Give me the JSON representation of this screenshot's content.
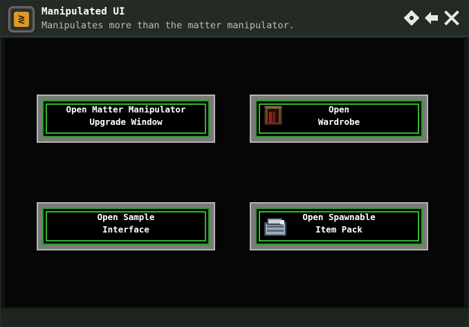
{
  "header": {
    "title": "Manipulated UI",
    "subtitle": "Manipulates more than the matter manipulator.",
    "app_icon": "starbound-logo-icon",
    "settings_icon": "gear-icon",
    "back_icon": "arrow-left-icon",
    "close_icon": "close-icon"
  },
  "buttons": [
    {
      "line1": "Open Matter Manipulator",
      "line2": "Upgrade Window",
      "icon": null
    },
    {
      "line1": "Open",
      "line2": "Wardrobe",
      "icon": "wardrobe-icon"
    },
    {
      "line1": "Open Sample",
      "line2": "Interface",
      "icon": null
    },
    {
      "line1": "Open Spawnable",
      "line2": "Item Pack",
      "icon": "item-pack-icon"
    }
  ],
  "colors": {
    "accent_green": "#33b433",
    "logo_orange": "#d99a2a"
  }
}
